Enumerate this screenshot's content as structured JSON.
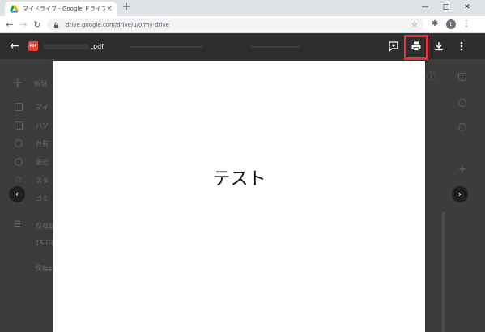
{
  "browser": {
    "tab_title": "マイドライブ - Google ドライブ",
    "tab_close": "×",
    "new_tab": "+",
    "url": "drive.google.com/drive/u/0/my-drive",
    "profile_initial": "t"
  },
  "viewer": {
    "file_badge": "PDF",
    "file_name_suffix": ".pdf"
  },
  "document": {
    "text": "テスト"
  },
  "drive_background": {
    "new_label": "新規",
    "sidebar": [
      "マイ",
      "パソ",
      "共有",
      "最近",
      "スタ",
      "ゴミ"
    ],
    "storage_label": "保存容",
    "storage_usage": "15 GB",
    "storage_buy": "保存容"
  },
  "colors": {
    "highlight": "#e5343c",
    "pdf_badge": "#ea4335",
    "viewer_header": "#2d2d2d"
  }
}
